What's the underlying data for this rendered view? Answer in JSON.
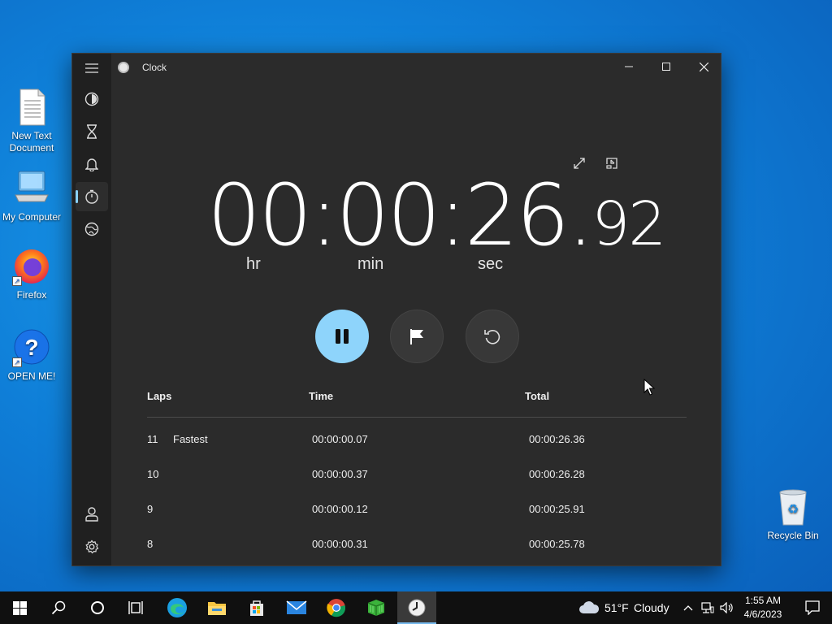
{
  "desktop": {
    "icons": [
      {
        "label_line1": "New Text",
        "label_line2": "Document",
        "icon": "text-document-icon"
      },
      {
        "label_line1": "My Computer",
        "icon": "computer-icon"
      },
      {
        "label_line1": "Firefox",
        "icon": "firefox-icon"
      },
      {
        "label_line1": "OPEN ME!",
        "icon": "help-question-icon"
      }
    ],
    "recycle_bin": {
      "label": "Recycle Bin",
      "icon": "recycle-bin-icon"
    }
  },
  "window": {
    "title": "Clock",
    "controls": {
      "minimize": "—",
      "maximize": "☐",
      "close": "✕"
    },
    "nav_items": [
      {
        "name": "focus-sessions",
        "icon": "focus-icon"
      },
      {
        "name": "timer",
        "icon": "hourglass-icon"
      },
      {
        "name": "alarm",
        "icon": "bell-icon"
      },
      {
        "name": "stopwatch",
        "icon": "stopwatch-icon",
        "active": true
      },
      {
        "name": "world-clock",
        "icon": "globe-icon"
      }
    ],
    "nav_bottom": [
      {
        "name": "account",
        "icon": "person-icon"
      },
      {
        "name": "settings",
        "icon": "gear-icon"
      }
    ]
  },
  "stopwatch": {
    "hours": "00",
    "sep1": ":",
    "minutes": "00",
    "sep2": ":",
    "seconds": "26",
    "dot": ".",
    "hundredths": "92",
    "unit_hr": "hr",
    "unit_min": "min",
    "unit_sec": "sec",
    "buttons": {
      "pause": "pause-icon",
      "lap": "flag-icon",
      "reset": "reset-icon",
      "expand": "expand-icon",
      "compact": "compact-overlay-icon"
    }
  },
  "laps": {
    "headers": {
      "laps": "Laps",
      "time": "Time",
      "total": "Total"
    },
    "rows": [
      {
        "num": "11",
        "tag": "Fastest",
        "time": "00:00:00.07",
        "total": "00:00:26.36"
      },
      {
        "num": "10",
        "tag": "",
        "time": "00:00:00.37",
        "total": "00:00:26.28"
      },
      {
        "num": "9",
        "tag": "",
        "time": "00:00:00.12",
        "total": "00:00:25.91"
      },
      {
        "num": "8",
        "tag": "",
        "time": "00:00:00.31",
        "total": "00:00:25.78"
      }
    ]
  },
  "taskbar": {
    "weather": {
      "temp": "51°F",
      "condition": "Cloudy"
    },
    "time": "1:55 AM",
    "date": "4/6/2023",
    "apps": [
      "start",
      "search",
      "cortana",
      "task-view",
      "edge",
      "file-explorer",
      "store",
      "mail",
      "chrome",
      "minecraft",
      "clock"
    ]
  },
  "colors": {
    "accent": "#8ed4fb",
    "window_bg": "#2b2b2b",
    "nav_bg": "#202020",
    "taskbar_bg": "#101010"
  }
}
